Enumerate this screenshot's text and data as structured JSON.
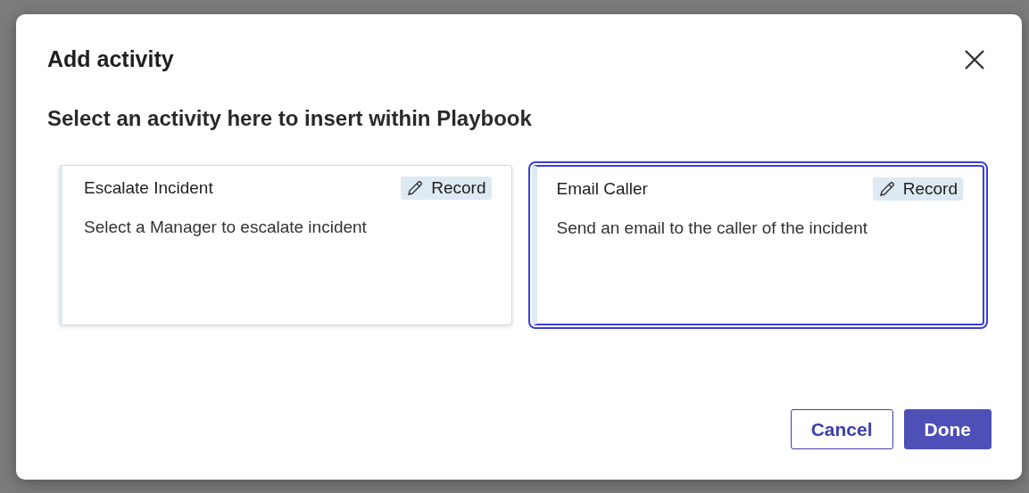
{
  "dialog": {
    "title": "Add activity",
    "heading": "Select an activity here to insert within Playbook"
  },
  "activities": [
    {
      "name": "Escalate Incident",
      "tag": "Record",
      "description": "Select a Manager to escalate incident",
      "selected": false
    },
    {
      "name": "Email Caller",
      "tag": "Record",
      "description": "Send an email to the caller of the incident",
      "selected": true
    }
  ],
  "buttons": [
    {
      "label": "Cancel",
      "kind": "secondary"
    },
    {
      "label": "Done",
      "kind": "primary"
    }
  ]
}
